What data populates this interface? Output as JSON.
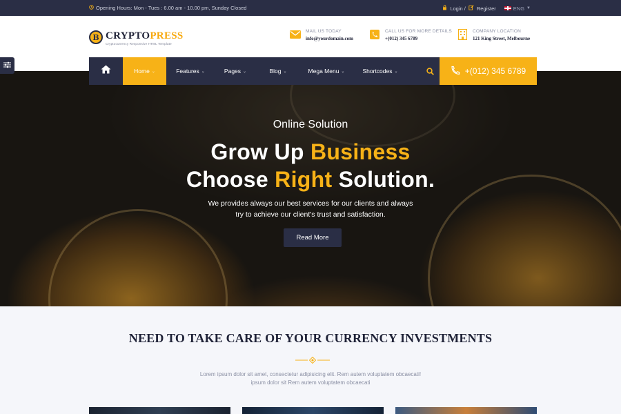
{
  "topbar": {
    "hours": "Opening Hours: Mon - Tues : 6.00 am - 10.00 pm, Sunday Closed",
    "login": "Login /",
    "register": "Register",
    "language": "ENG"
  },
  "logo": {
    "name_a": "CRYPTO",
    "name_b": "PRESS",
    "tagline": "Cryptocurrency Responsive HTML Template",
    "coin_letter": "B"
  },
  "header_info": [
    {
      "label": "MAIL US TODAY",
      "value": "info@yourdomain.com"
    },
    {
      "label": "CALL US FOR MORE DETAILS",
      "value": "+(012) 345 6789"
    },
    {
      "label": "COMPANY LOCATION",
      "value": "121 King Street, Melbourne"
    }
  ],
  "nav": {
    "items": [
      "Home",
      "Features",
      "Pages",
      "Blog",
      "Mega Menu",
      "Shortcodes"
    ],
    "active": "Home",
    "phone": "+(012) 345 6789"
  },
  "hero": {
    "kicker": "Online Solution",
    "line1_a": "Grow Up ",
    "line1_b": "Business",
    "line2_a": "Choose ",
    "line2_b": "Right",
    "line2_c": " Solution.",
    "desc1": "We provides always our best services for our clients and always",
    "desc2": "try to achieve our client's trust and satisfaction.",
    "button": "Read More"
  },
  "section": {
    "title": "NEED TO TAKE CARE OF YOUR CURRENCY INVESTMENTS",
    "desc1": "Lorem ipsum dolor sit amet, consectetur adipisicing elit. Rem autem voluptatem obcaecati!",
    "desc2": "ipsum dolor sit Rem autem voluptatem obcaecati"
  },
  "colors": {
    "accent": "#f7b217",
    "navy": "#2a2e45",
    "text_dark": "#1f2237"
  }
}
